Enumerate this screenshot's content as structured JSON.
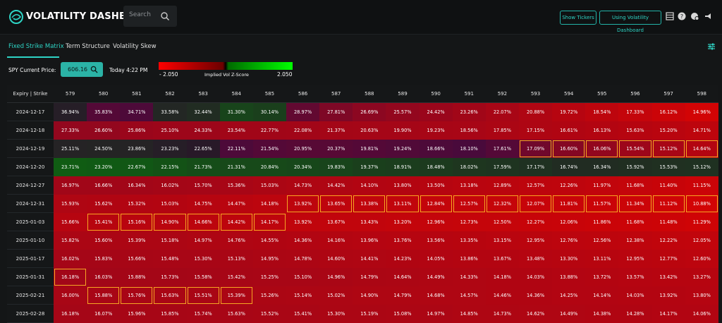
{
  "header": {
    "title": "VOLATILITY DASHBOARD",
    "search_placeholder": "Search",
    "buttons": {
      "show_tickers": "Show Tickers",
      "using_dashboard": "Using Volatility Dashboard"
    },
    "icons": [
      "logo-icon",
      "search-icon",
      "table-icon",
      "help-icon",
      "alerts-icon",
      "announce-icon"
    ]
  },
  "nav": {
    "tabs": [
      {
        "label": "Fixed Strike Matrix",
        "active": true
      },
      {
        "label": "Term Structure",
        "active": false
      },
      {
        "label": "Volatility Skew",
        "active": false
      }
    ]
  },
  "controls": {
    "price_label": "SPY Current Price:",
    "price": "606.16",
    "timestamp": "Today 4:22 PM",
    "zscore_label": "Implied Vol Z-Score",
    "zscore_min": "- 2.050",
    "zscore_max": "2.050"
  },
  "colors": {
    "accent": "#2ed4c5",
    "highlight": "#f5a623",
    "negative": "#d00000",
    "positive": "#00b000"
  },
  "matrix": {
    "corner": "Expiry | Strike",
    "strikes": [
      "579",
      "580",
      "581",
      "582",
      "583",
      "584",
      "585",
      "586",
      "587",
      "588",
      "589",
      "590",
      "591",
      "592",
      "593",
      "594",
      "595",
      "596",
      "597",
      "598"
    ],
    "rows": [
      {
        "expiry": "2024-12-17",
        "values": [
          "36.94%",
          "35.83%",
          "34.71%",
          "33.58%",
          "32.44%",
          "31.30%",
          "30.14%",
          "28.97%",
          "27.81%",
          "26.69%",
          "25.57%",
          "24.42%",
          "23.26%",
          "22.07%",
          "20.88%",
          "19.72%",
          "18.54%",
          "17.33%",
          "16.12%",
          "14.96%"
        ],
        "z": [
          0.05,
          -0.1,
          -0.05,
          0.15,
          0.2,
          0.45,
          0.4,
          -0.2,
          -0.4,
          -0.5,
          -0.55,
          -0.6,
          -0.65,
          -0.7,
          -0.75,
          -0.8,
          -0.85,
          -0.9,
          -0.95,
          -1.0
        ]
      },
      {
        "expiry": "2024-12-18",
        "values": [
          "27.33%",
          "26.60%",
          "25.86%",
          "25.10%",
          "24.33%",
          "23.54%",
          "22.77%",
          "22.08%",
          "21.37%",
          "20.63%",
          "19.90%",
          "19.23%",
          "18.56%",
          "17.85%",
          "17.15%",
          "16.61%",
          "16.13%",
          "15.63%",
          "15.20%",
          "14.71%"
        ],
        "z": [
          -0.55,
          -0.55,
          -0.6,
          -0.62,
          -0.62,
          -0.65,
          -0.65,
          -0.66,
          -0.67,
          -0.68,
          -0.68,
          -0.69,
          -0.7,
          -0.72,
          -0.74,
          -0.76,
          -0.78,
          -0.8,
          -0.82,
          -0.85
        ]
      },
      {
        "expiry": "2024-12-19",
        "values": [
          "25.11%",
          "24.50%",
          "23.86%",
          "23.23%",
          "22.65%",
          "22.11%",
          "21.54%",
          "20.95%",
          "20.37%",
          "19.81%",
          "19.24%",
          "18.66%",
          "18.10%",
          "17.61%",
          "17.09%",
          "16.60%",
          "16.06%",
          "15.54%",
          "15.12%",
          "14.64%"
        ],
        "z": [
          0.1,
          0.12,
          0.1,
          0.05,
          0.0,
          -0.05,
          -0.1,
          -0.12,
          -0.12,
          -0.1,
          -0.08,
          -0.05,
          -0.02,
          -0.1,
          -0.3,
          -0.45,
          -0.55,
          -0.62,
          -0.7,
          -0.78
        ]
      },
      {
        "expiry": "2024-12-20",
        "values": [
          "23.71%",
          "23.20%",
          "22.67%",
          "22.15%",
          "21.73%",
          "21.31%",
          "20.84%",
          "20.34%",
          "19.83%",
          "19.37%",
          "18.91%",
          "18.48%",
          "18.02%",
          "17.59%",
          "17.17%",
          "16.74%",
          "16.34%",
          "15.92%",
          "15.53%",
          "15.12%"
        ],
        "z": [
          0.7,
          0.68,
          0.65,
          0.6,
          0.55,
          0.5,
          0.5,
          0.48,
          0.45,
          0.4,
          0.38,
          0.35,
          0.3,
          0.28,
          0.25,
          0.2,
          0.2,
          0.22,
          0.24,
          0.25
        ]
      },
      {
        "expiry": "2024-12-27",
        "values": [
          "16.97%",
          "16.66%",
          "16.34%",
          "16.02%",
          "15.70%",
          "15.36%",
          "15.03%",
          "14.73%",
          "14.42%",
          "14.10%",
          "13.80%",
          "13.50%",
          "13.18%",
          "12.89%",
          "12.57%",
          "12.26%",
          "11.97%",
          "11.68%",
          "11.40%",
          "11.15%"
        ],
        "z": [
          -0.65,
          -0.65,
          -0.66,
          -0.67,
          -0.68,
          -0.7,
          -0.72,
          -0.74,
          -0.75,
          -0.77,
          -0.78,
          -0.8,
          -0.82,
          -0.83,
          -0.85,
          -0.86,
          -0.88,
          -0.9,
          -0.92,
          -0.95
        ]
      },
      {
        "expiry": "2024-12-31",
        "values": [
          "15.93%",
          "15.62%",
          "15.32%",
          "15.03%",
          "14.75%",
          "14.47%",
          "14.18%",
          "13.92%",
          "13.65%",
          "13.38%",
          "13.11%",
          "12.84%",
          "12.57%",
          "12.32%",
          "12.07%",
          "11.81%",
          "11.57%",
          "11.34%",
          "11.12%",
          "10.88%"
        ],
        "z": [
          -0.75,
          -0.76,
          -0.77,
          -0.78,
          -0.8,
          -0.82,
          -0.84,
          -0.85,
          -0.86,
          -0.87,
          -0.88,
          -0.89,
          -0.9,
          -0.91,
          -0.92,
          -0.93,
          -0.94,
          -0.95,
          -0.97,
          -1.0
        ]
      },
      {
        "expiry": "2025-01-03",
        "values": [
          "15.66%",
          "15.41%",
          "15.16%",
          "14.90%",
          "14.66%",
          "14.42%",
          "14.17%",
          "13.92%",
          "13.67%",
          "13.43%",
          "13.20%",
          "12.96%",
          "12.73%",
          "12.50%",
          "12.27%",
          "12.06%",
          "11.86%",
          "11.68%",
          "11.48%",
          "11.29%"
        ],
        "z": [
          -0.8,
          -0.81,
          -0.82,
          -0.83,
          -0.84,
          -0.85,
          -0.86,
          -0.87,
          -0.88,
          -0.88,
          -0.89,
          -0.9,
          -0.91,
          -0.91,
          -0.92,
          -0.93,
          -0.94,
          -0.95,
          -0.96,
          -0.98
        ]
      },
      {
        "expiry": "2025-01-10",
        "values": [
          "15.82%",
          "15.60%",
          "15.39%",
          "15.18%",
          "14.97%",
          "14.76%",
          "14.55%",
          "14.36%",
          "14.16%",
          "13.96%",
          "13.76%",
          "13.56%",
          "13.35%",
          "13.15%",
          "12.95%",
          "12.76%",
          "12.56%",
          "12.38%",
          "12.22%",
          "12.05%"
        ],
        "z": [
          -0.72,
          -0.72,
          -0.73,
          -0.73,
          -0.74,
          -0.75,
          -0.76,
          -0.77,
          -0.78,
          -0.79,
          -0.8,
          -0.8,
          -0.81,
          -0.82,
          -0.83,
          -0.84,
          -0.85,
          -0.86,
          -0.87,
          -0.88
        ]
      },
      {
        "expiry": "2025-01-17",
        "values": [
          "16.02%",
          "15.83%",
          "15.66%",
          "15.48%",
          "15.30%",
          "15.13%",
          "14.95%",
          "14.78%",
          "14.60%",
          "14.41%",
          "14.23%",
          "14.05%",
          "13.86%",
          "13.67%",
          "13.48%",
          "13.30%",
          "13.11%",
          "12.95%",
          "12.77%",
          "12.60%"
        ],
        "z": [
          -0.68,
          -0.68,
          -0.69,
          -0.7,
          -0.7,
          -0.71,
          -0.72,
          -0.73,
          -0.74,
          -0.75,
          -0.76,
          -0.77,
          -0.78,
          -0.78,
          -0.79,
          -0.8,
          -0.81,
          -0.82,
          -0.83,
          -0.84
        ]
      },
      {
        "expiry": "2025-01-31",
        "values": [
          "16.18%",
          "16.03%",
          "15.88%",
          "15.73%",
          "15.58%",
          "15.42%",
          "15.25%",
          "15.10%",
          "14.96%",
          "14.79%",
          "14.64%",
          "14.49%",
          "14.33%",
          "14.18%",
          "14.03%",
          "13.88%",
          "13.72%",
          "13.57%",
          "13.42%",
          "13.27%"
        ],
        "z": [
          -0.66,
          -0.66,
          -0.67,
          -0.67,
          -0.68,
          -0.69,
          -0.7,
          -0.7,
          -0.71,
          -0.72,
          -0.73,
          -0.74,
          -0.75,
          -0.76,
          -0.76,
          -0.77,
          -0.78,
          -0.79,
          -0.8,
          -0.8
        ]
      },
      {
        "expiry": "2025-02-21",
        "values": [
          "16.00%",
          "15.88%",
          "15.76%",
          "15.63%",
          "15.51%",
          "15.39%",
          "15.26%",
          "15.14%",
          "15.02%",
          "14.90%",
          "14.79%",
          "14.68%",
          "14.57%",
          "14.46%",
          "14.36%",
          "14.25%",
          "14.14%",
          "14.03%",
          "13.92%",
          "13.80%"
        ],
        "z": [
          -0.7,
          -0.7,
          -0.7,
          -0.71,
          -0.71,
          -0.72,
          -0.72,
          -0.73,
          -0.73,
          -0.74,
          -0.74,
          -0.75,
          -0.75,
          -0.76,
          -0.76,
          -0.77,
          -0.77,
          -0.78,
          -0.78,
          -0.79
        ]
      },
      {
        "expiry": "2025-02-28",
        "values": [
          "16.18%",
          "16.07%",
          "15.96%",
          "15.85%",
          "15.74%",
          "15.63%",
          "15.52%",
          "15.41%",
          "15.30%",
          "15.19%",
          "15.08%",
          "14.97%",
          "14.85%",
          "14.73%",
          "14.62%",
          "14.49%",
          "14.38%",
          "14.28%",
          "14.17%",
          "14.06%"
        ],
        "z": [
          -0.68,
          -0.68,
          -0.69,
          -0.69,
          -0.7,
          -0.7,
          -0.71,
          -0.71,
          -0.72,
          -0.72,
          -0.73,
          -0.73,
          -0.74,
          -0.74,
          -0.75,
          -0.75,
          -0.76,
          -0.76,
          -0.77,
          -0.77
        ]
      }
    ],
    "highlights": [
      {
        "row": 2,
        "cols": [
          14,
          15,
          16,
          17,
          18,
          19
        ]
      },
      {
        "row": 5,
        "cols": [
          7,
          8,
          9,
          10,
          11,
          12,
          13,
          14,
          15,
          16,
          17,
          18,
          19
        ]
      },
      {
        "row": 6,
        "cols": [
          1,
          2,
          3,
          4,
          5,
          6
        ]
      },
      {
        "row": 9,
        "cols": [
          0
        ]
      },
      {
        "row": 10,
        "cols": [
          1,
          2,
          3,
          4,
          5
        ]
      }
    ]
  }
}
